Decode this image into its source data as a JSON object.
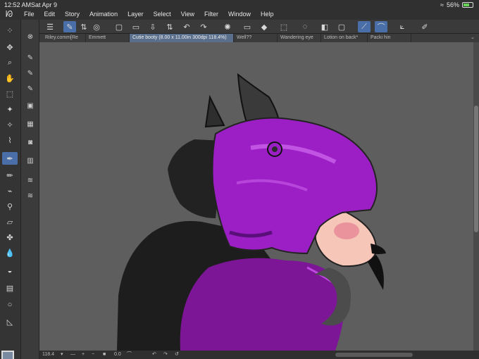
{
  "status": {
    "time": "12:52 AM",
    "date": "Sat Apr 9",
    "battery": "56%",
    "battery_level": 0.56
  },
  "menu": {
    "items": [
      "File",
      "Edit",
      "Story",
      "Animation",
      "Layer",
      "Select",
      "View",
      "Filter",
      "Window",
      "Help"
    ]
  },
  "tabs": [
    {
      "label": "Riley.comm[Re",
      "active": false
    },
    {
      "label": "Emmett",
      "active": false
    },
    {
      "label": "Cutie booty (8.00 x 11.00in 300dpi 118.4%)",
      "active": true
    },
    {
      "label": "Well??",
      "active": false
    },
    {
      "label": "Wandering eye",
      "active": false
    },
    {
      "label": "Lotion on back*",
      "active": false
    },
    {
      "label": "Packi hin",
      "active": false
    }
  ],
  "bottom": {
    "zoom": "118.4",
    "angle": "0.0"
  },
  "colors": {
    "canvas_bg": "#5e5e5e",
    "hair": "#9b1fc4",
    "hair_light": "#c24ae6",
    "hair_dark": "#5a0f7a",
    "fur_dark": "#1f1f1f",
    "shirt": "#7c1696",
    "skin": "#f6c6b8",
    "blush": "#e88a98",
    "accent": "#4a6fa8"
  }
}
